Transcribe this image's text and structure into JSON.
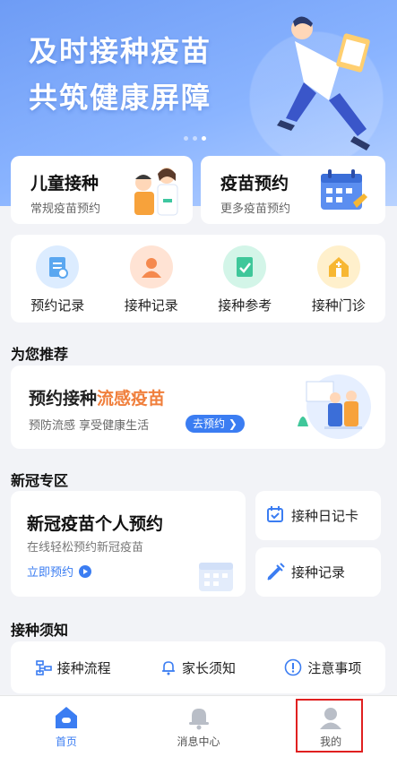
{
  "banner": {
    "line1": "及时接种疫苗",
    "line2": "共筑健康屏障"
  },
  "cards": {
    "child": {
      "title": "儿童接种",
      "sub": "常规疫苗预约"
    },
    "vaccine": {
      "title": "疫苗预约",
      "sub": "更多疫苗预约"
    }
  },
  "quick": [
    {
      "label": "预约记录",
      "color": "#5aa7f0"
    },
    {
      "label": "接种记录",
      "color": "#f5894e"
    },
    {
      "label": "接种参考",
      "color": "#3fc79a"
    },
    {
      "label": "接种门诊",
      "color": "#f7b733"
    }
  ],
  "recommend": {
    "section": "为您推荐",
    "title_a": "预约接种",
    "title_b": "流感疫苗",
    "sub": "预防流感 享受健康生活",
    "button": "去预约 ❯"
  },
  "covid": {
    "section": "新冠专区",
    "main_title": "新冠疫苗个人预约",
    "main_sub": "在线轻松预约新冠疫苗",
    "main_link": "立即预约",
    "diary": "接种日记卡",
    "record": "接种记录"
  },
  "notice": {
    "section": "接种须知",
    "items": [
      "接种流程",
      "家长须知",
      "注意事项"
    ]
  },
  "tabbar": {
    "home": "首页",
    "messages": "消息中心",
    "me": "我的"
  },
  "colors": {
    "accent": "#3b7df2",
    "highlight": "#f07f3c",
    "annotation": "#e02020"
  }
}
